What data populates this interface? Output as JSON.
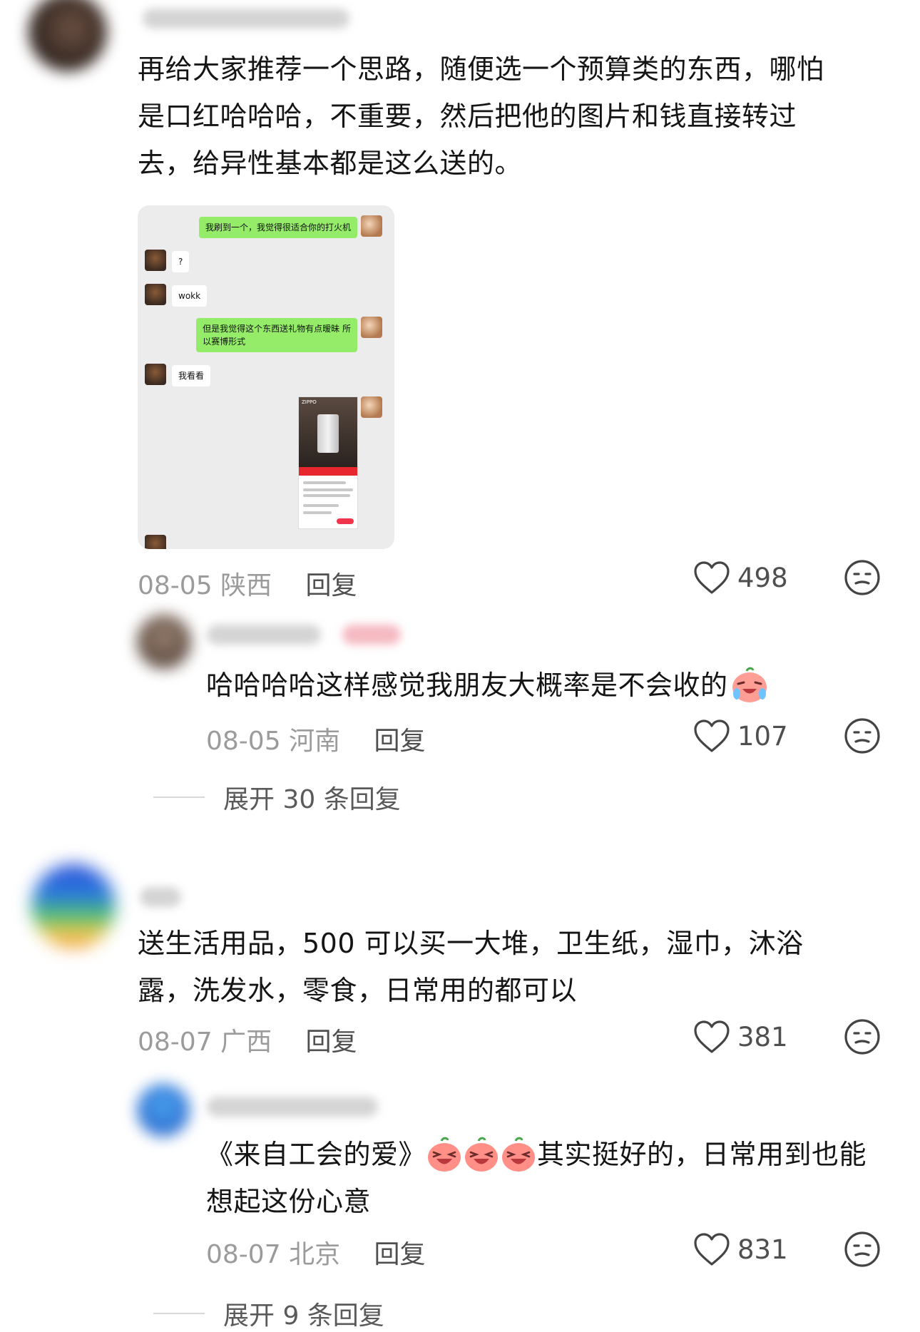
{
  "comments": [
    {
      "text_lines": [
        "再给大家推荐一个思路，随便选一个预算类的东西，哪怕",
        "是口红哈哈哈，不重要，然后把他的图片和钱直接转过",
        "去，给异性基本都是这么送的。"
      ],
      "date": "08-05",
      "location": "陕西",
      "reply_label": "回复",
      "likes": "498",
      "chat_screenshot": {
        "messages": [
          {
            "from": "me",
            "text": "我刷到一个，我觉得很适合你的打火机"
          },
          {
            "from": "friend",
            "text": "?"
          },
          {
            "from": "friend",
            "text": "wokk"
          },
          {
            "from": "me",
            "text_lines": [
              "但是我觉得这个东西送礼物有点暧昧 所",
              "以赛博形式"
            ]
          },
          {
            "from": "friend",
            "text": "我看看"
          }
        ],
        "product_brand": "ZIPPO"
      }
    },
    {
      "text": "哈哈哈哈这样感觉我朋友大概率是不会收的",
      "emoji": "crying-laugh-peach-emoji",
      "date": "08-05",
      "location": "河南",
      "reply_label": "回复",
      "likes": "107",
      "expand_label": "展开 30 条回复"
    },
    {
      "text_lines": [
        "送生活用品，500 可以买一大堆，卫生纸，湿巾，沐浴",
        "露，洗发水，零食，日常用的都可以"
      ],
      "date": "08-07",
      "location": "广西",
      "reply_label": "回复",
      "likes": "381"
    },
    {
      "text_line1_prefix": "《来自工会的爱》",
      "text_line1_suffix": "其实挺好的，日常用到也能",
      "text_line2": "想起这份心意",
      "emoji": "laughing-peach-emoji",
      "date": "08-07",
      "location": "北京",
      "reply_label": "回复",
      "likes": "831",
      "expand_label": "展开 9 条回复"
    }
  ]
}
